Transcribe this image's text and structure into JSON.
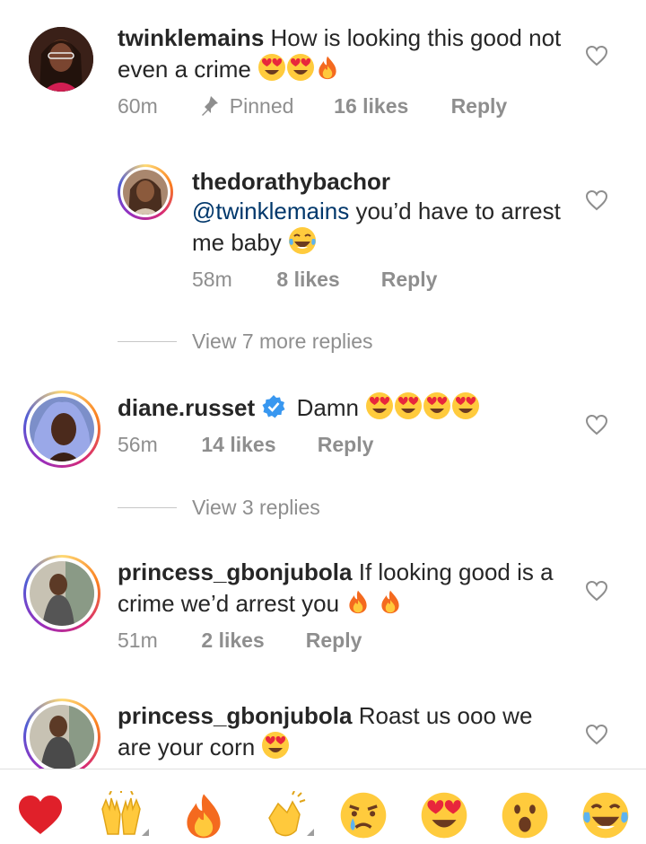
{
  "comments": [
    {
      "username": "twinklemains",
      "text": "How is looking this good not even a crime",
      "emojis": [
        "heart-eyes",
        "heart-eyes",
        "fire"
      ],
      "time": "60m",
      "pinned_label": "Pinned",
      "likes": "16 likes",
      "reply_label": "Reply"
    },
    {
      "username": "thedorathybachor",
      "mention": "@twinklemains",
      "text": "you’d have to arrest me baby",
      "emojis": [
        "tears-of-joy"
      ],
      "time": "58m",
      "likes": "8 likes",
      "reply_label": "Reply"
    },
    {
      "username": "diane.russet",
      "text": "Damn",
      "emojis": [
        "heart-eyes",
        "heart-eyes",
        "heart-eyes",
        "heart-eyes"
      ],
      "verified": true,
      "time": "56m",
      "likes": "14 likes",
      "reply_label": "Reply"
    },
    {
      "username": "princess_gbonjubola",
      "text": "If looking good is a crime we’d arrest you",
      "emojis": [
        "fire",
        "fire"
      ],
      "time": "51m",
      "likes": "2 likes",
      "reply_label": "Reply"
    },
    {
      "username": "princess_gbonjubola",
      "text": "Roast us ooo we are your corn",
      "emojis": [
        "heart-eyes"
      ]
    }
  ],
  "view_replies": [
    {
      "label": "View 7 more replies"
    },
    {
      "label": "View 3 replies"
    }
  ],
  "reactions": [
    "red-heart",
    "raising-hands",
    "fire",
    "clapping-hands",
    "sad-tear",
    "heart-eyes",
    "surprised",
    "tears-of-joy"
  ],
  "colors": {
    "text": "#262626",
    "muted": "#8e8e8e",
    "mention": "#00376b",
    "accent_heart": "#e0202a"
  }
}
